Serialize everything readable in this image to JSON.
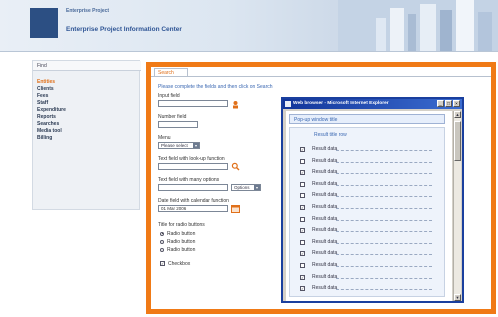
{
  "header": {
    "small_text": "Enterprise Project",
    "title": "Enterprise Project Information Center"
  },
  "nav": {
    "tab_label": "Find",
    "items": [
      {
        "label": "Entities",
        "active": true
      },
      {
        "label": "Clients"
      },
      {
        "label": "Fees"
      },
      {
        "label": "Staff"
      },
      {
        "label": "Expenditure"
      },
      {
        "label": "Reports"
      },
      {
        "label": "Searches"
      },
      {
        "label": "Media tool"
      },
      {
        "label": "Billing"
      }
    ]
  },
  "main": {
    "tab_label": "Search",
    "intro": "Please complete the fields and then click on Search",
    "fields": {
      "input_label": "Input field",
      "number_label": "Number field",
      "menu_label": "Menu",
      "menu_value": "Please select",
      "lookup_label": "Text field with look-up function",
      "many_options_label": "Text field with many options",
      "many_options_select": "Options",
      "date_label": "Date field with calendar function",
      "date_value": "01 Mar 2006",
      "radio_title": "Title for radio buttons",
      "radios": [
        {
          "label": "Radio button",
          "checked": true
        },
        {
          "label": "Radio button",
          "checked": false
        },
        {
          "label": "Radio button",
          "checked": false
        }
      ],
      "checkbox_label": "Checkbox",
      "checkbox_checked": true
    }
  },
  "popup": {
    "title": "Web browser - Microsoft Internet Explorer",
    "header": "Pop-up window title",
    "list_heading": "Result title row",
    "rows": [
      {
        "label": "Result data",
        "checked": true
      },
      {
        "label": "Result data",
        "checked": false
      },
      {
        "label": "Result data",
        "checked": true
      },
      {
        "label": "Result data",
        "checked": false
      },
      {
        "label": "Result data",
        "checked": false
      },
      {
        "label": "Result data",
        "checked": true
      },
      {
        "label": "Result data",
        "checked": false
      },
      {
        "label": "Result data",
        "checked": true
      },
      {
        "label": "Result data",
        "checked": false
      },
      {
        "label": "Result data",
        "checked": true
      },
      {
        "label": "Result data",
        "checked": false
      },
      {
        "label": "Result data",
        "checked": true
      },
      {
        "label": "Result data",
        "checked": true
      }
    ],
    "buttons": {
      "minimize": "_",
      "maximize": "□",
      "close": "×"
    }
  },
  "colors": {
    "accent_orange": "#f07a16",
    "brand_blue": "#2c4f83",
    "link_blue": "#3b68b2"
  },
  "icons": {
    "lookup": "magnifier-icon",
    "date": "calendar-icon",
    "user": "user-lookup-icon"
  }
}
